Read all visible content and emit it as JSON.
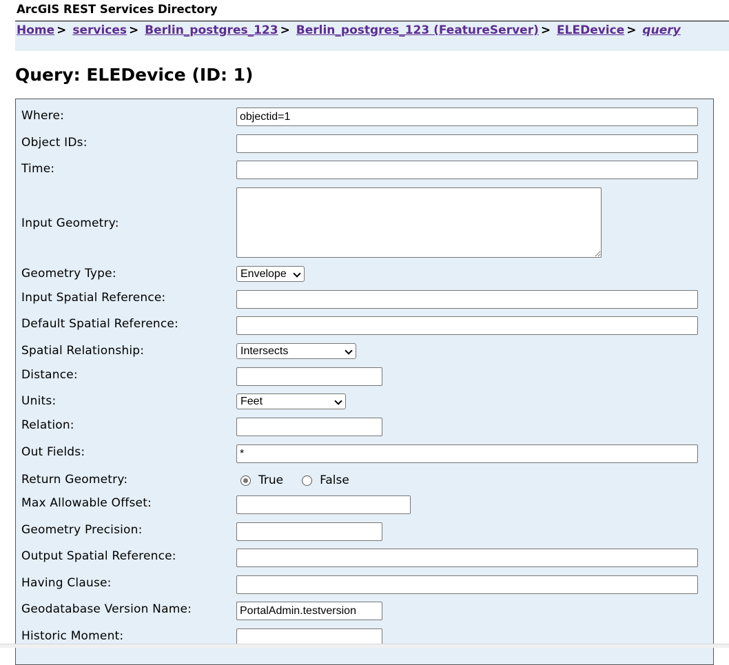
{
  "app": {
    "title": "ArcGIS REST Services Directory"
  },
  "breadcrumb": [
    {
      "label": "Home"
    },
    {
      "label": "services"
    },
    {
      "label": "Berlin_postgres_123"
    },
    {
      "label": "Berlin_postgres_123 (FeatureServer)"
    },
    {
      "label": "ELEDevice"
    },
    {
      "label": "query"
    }
  ],
  "breadcrumb_separator": ">",
  "page": {
    "title": "Query: ELEDevice (ID: 1)"
  },
  "form": {
    "where": {
      "label": "Where:",
      "value": "objectid=1"
    },
    "object_ids": {
      "label": "Object IDs:",
      "value": ""
    },
    "time": {
      "label": "Time:",
      "value": ""
    },
    "input_geometry": {
      "label": "Input Geometry:",
      "value": ""
    },
    "geometry_type": {
      "label": "Geometry Type:",
      "selected": "Envelope"
    },
    "input_sr": {
      "label": "Input Spatial Reference:",
      "value": ""
    },
    "default_sr": {
      "label": "Default Spatial Reference:",
      "value": ""
    },
    "spatial_rel": {
      "label": "Spatial Relationship:",
      "selected": "Intersects"
    },
    "distance": {
      "label": "Distance:",
      "value": ""
    },
    "units": {
      "label": "Units:",
      "selected": "Feet"
    },
    "relation": {
      "label": "Relation:",
      "value": ""
    },
    "out_fields": {
      "label": "Out Fields:",
      "value": "*"
    },
    "return_geometry": {
      "label": "Return Geometry:",
      "true_label": "True",
      "false_label": "False",
      "selected": "True"
    },
    "max_offset": {
      "label": "Max Allowable Offset:",
      "value": ""
    },
    "geom_precision": {
      "label": "Geometry Precision:",
      "value": ""
    },
    "output_sr": {
      "label": "Output Spatial Reference:",
      "value": ""
    },
    "having": {
      "label": "Having Clause:",
      "value": ""
    },
    "gdb_version": {
      "label": "Geodatabase Version Name:",
      "value": "PortalAdmin.testversion"
    },
    "historic_moment": {
      "label": "Historic Moment:",
      "value": ""
    }
  },
  "colors": {
    "panel_bg": "#e5eff7",
    "link": "#5c2d91"
  }
}
